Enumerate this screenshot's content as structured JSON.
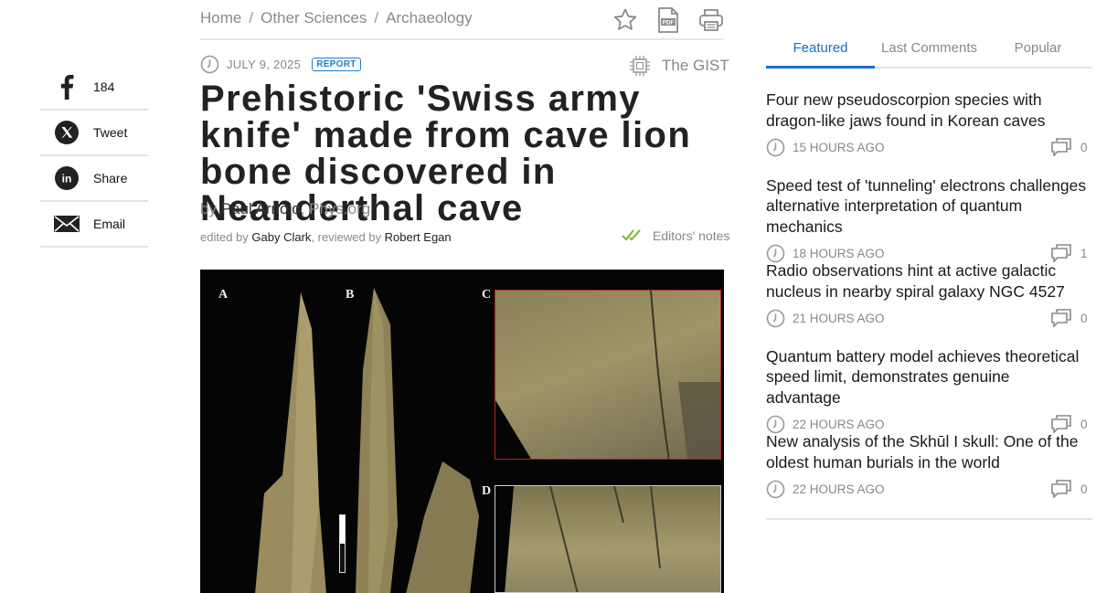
{
  "share": {
    "items": [
      {
        "icon": "facebook-icon",
        "label": "184"
      },
      {
        "icon": "x-icon",
        "label": "Tweet"
      },
      {
        "icon": "linkedin-icon",
        "label": "Share"
      },
      {
        "icon": "email-icon",
        "label": "Email"
      }
    ]
  },
  "breadcrumb": [
    "Home",
    "Other Sciences",
    "Archaeology"
  ],
  "breadcrumb_sep": "/",
  "tools": [
    "star-icon",
    "pdf-icon",
    "print-icon"
  ],
  "article": {
    "date": "JULY 9, 2025",
    "badge": "REPORT",
    "gist_label": "The GIST",
    "title": "Prehistoric 'Swiss army knife' made from cave lion bone discovered in Neanderthal cave",
    "by": "by",
    "author": "Paul Arnold",
    "comma": ",",
    "source": "Phys.org",
    "edited_by": "edited by",
    "editor": "Gaby Clark",
    "reviewed_by": ", reviewed by",
    "reviewer": "Robert Egan",
    "editors_notes": "Editors' notes",
    "figure_letters": [
      "A",
      "B",
      "C",
      "D"
    ]
  },
  "sidebar": {
    "tabs": [
      {
        "label": "Featured",
        "active": true
      },
      {
        "label": "Last Comments",
        "active": false
      },
      {
        "label": "Popular",
        "active": false
      }
    ],
    "news": [
      {
        "title": "Four new pseudoscorpion species with dragon-like jaws found in Korean caves",
        "ago": "15 HOURS AGO",
        "comments": "0"
      },
      {
        "title": "Speed test of 'tunneling' electrons challenges alternative interpretation of quantum mechanics",
        "ago": "18 HOURS AGO",
        "comments": "1"
      },
      {
        "title": "Radio observations hint at active galactic nucleus in nearby spiral galaxy NGC 4527",
        "ago": "21 HOURS AGO",
        "comments": "0"
      },
      {
        "title": "Quantum battery model achieves theoretical speed limit, demonstrates genuine advantage",
        "ago": "22 HOURS AGO",
        "comments": "0"
      },
      {
        "title": "New analysis of the Skhūl I skull: One of the oldest human burials in the world",
        "ago": "22 HOURS AGO",
        "comments": "0"
      }
    ]
  },
  "colors": {
    "accent": "#1a6fc4",
    "badge": "#1d7fd0",
    "text": "#222222",
    "muted": "#888888"
  }
}
